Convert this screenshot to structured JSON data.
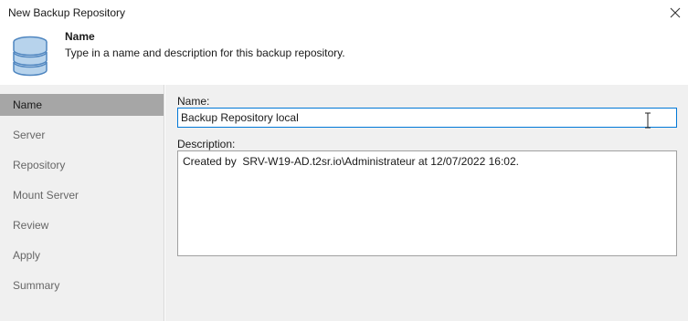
{
  "window": {
    "title": "New Backup Repository",
    "close_icon": "close-icon"
  },
  "header": {
    "icon": "database-icon",
    "title": "Name",
    "description": "Type in a name and description for this backup repository."
  },
  "sidebar": {
    "items": [
      {
        "label": "Name",
        "selected": true
      },
      {
        "label": "Server",
        "selected": false
      },
      {
        "label": "Repository",
        "selected": false
      },
      {
        "label": "Mount Server",
        "selected": false
      },
      {
        "label": "Review",
        "selected": false
      },
      {
        "label": "Apply",
        "selected": false
      },
      {
        "label": "Summary",
        "selected": false
      }
    ]
  },
  "form": {
    "name_label": "Name:",
    "name_value": "Backup Repository local",
    "description_label": "Description:",
    "description_value": "Created by  SRV-W19-AD.t2sr.io\\Administrateur at 12/07/2022 16:02."
  },
  "colors": {
    "accent_border": "#0078d7",
    "sidebar_bg": "#f0f0f0",
    "selected_bg": "#a6a6a6"
  }
}
